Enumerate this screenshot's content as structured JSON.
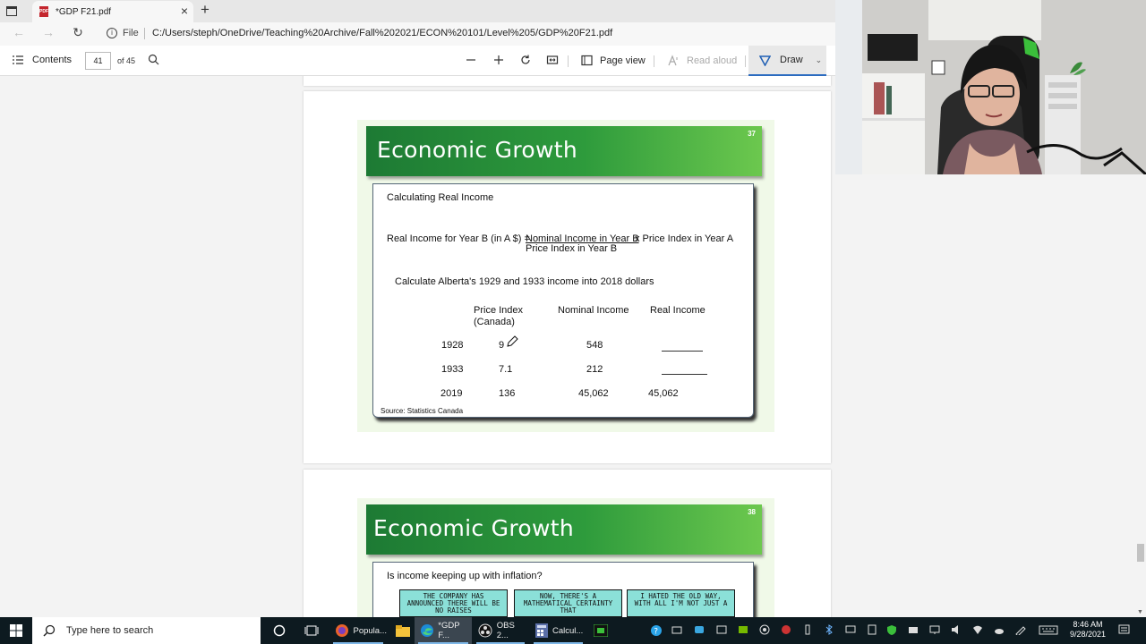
{
  "browser": {
    "tab_title": "*GDP F21.pdf",
    "tab_icon": "pdf-icon",
    "file_label": "File",
    "url": "C:/Users/steph/OneDrive/Teaching%20Archive/Fall%202021/ECON%20101/Level%205/GDP%20F21.pdf"
  },
  "pdf_toolbar": {
    "contents_label": "Contents",
    "page_number": "41",
    "page_of": "of 45",
    "page_view_label": "Page view",
    "read_aloud_label": "Read aloud",
    "draw_label": "Draw"
  },
  "slide1": {
    "title": "Economic Growth",
    "number": "37",
    "heading": "Calculating Real Income",
    "formula_left": "Real Income for Year B (in A $) =",
    "formula_numerator": "Nominal Income in Year B",
    "formula_times": "x Price Index in Year A",
    "formula_denominator": "Price Index in Year B",
    "instruction": "Calculate Alberta's 1929 and 1933 income into 2018 dollars",
    "table": {
      "headers": [
        "Price Index",
        "(Canada)",
        "Nominal Income",
        "Real Income"
      ],
      "rows": [
        {
          "year": "1928",
          "price_index": "9",
          "nominal": "548",
          "real": ""
        },
        {
          "year": "1933",
          "price_index": "7.1",
          "nominal": "212",
          "real": ""
        },
        {
          "year": "2019",
          "price_index": "136",
          "nominal": "45,062",
          "real": "45,062"
        }
      ]
    },
    "source": "Source: Statistics Canada"
  },
  "slide2": {
    "title": "Economic Growth",
    "number": "38",
    "question": "Is income keeping up with inflation?",
    "comic_panels": [
      "THE COMPANY HAS ANNOUNCED THERE WILL BE NO RAISES",
      "NOW, THERE'S A MATHEMATICAL CERTAINTY THAT",
      "I HATED THE OLD WAY, WITH ALL       I'M NOT JUST A"
    ]
  },
  "taskbar": {
    "search_placeholder": "Type here to search",
    "apps": [
      {
        "label": "Popula...",
        "icon": "firefox-icon"
      },
      {
        "label": "*GDP F...",
        "icon": "edge-icon"
      },
      {
        "label": "OBS 2...",
        "icon": "obs-icon"
      },
      {
        "label": "Calcul...",
        "icon": "calculator-icon"
      }
    ],
    "time": "8:46 AM",
    "date": "9/28/2021"
  }
}
